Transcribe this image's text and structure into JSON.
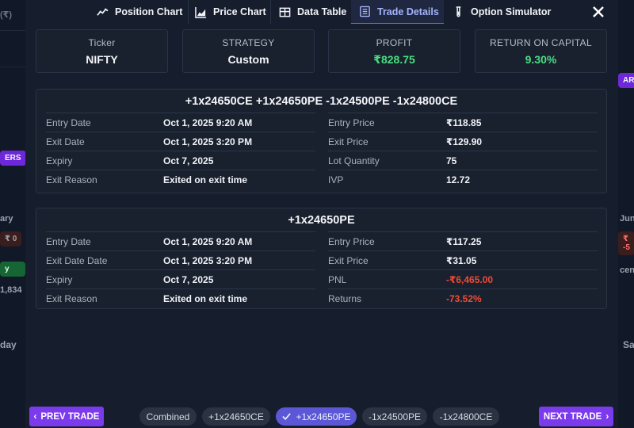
{
  "background": {
    "fragments": {
      "tl": "(₹)",
      "ers": "ERS",
      "ary": "ary",
      "zero": "₹ 0",
      "y": "y",
      "num": "1,834",
      "day": "day",
      "art": "ART",
      "june": "June",
      "neg": "₹ -5",
      "cen": "cen",
      "sa": "Sa"
    }
  },
  "tabs": [
    {
      "label": "Position Chart",
      "icon": "trend-line-icon"
    },
    {
      "label": "Price Chart",
      "icon": "area-chart-icon"
    },
    {
      "label": "Data Table",
      "icon": "table-icon"
    },
    {
      "label": "Trade Details",
      "icon": "document-list-icon",
      "active": true
    },
    {
      "label": "Option Simulator",
      "icon": "test-tube-icon"
    }
  ],
  "stats": [
    {
      "label": "Ticker",
      "value": "NIFTY"
    },
    {
      "label": "STRATEGY",
      "value": "Custom"
    },
    {
      "label": "PROFIT",
      "value": "₹828.75"
    },
    {
      "label": "RETURN ON CAPITAL",
      "value": "9.30%"
    }
  ],
  "combined_card": {
    "title": "+1x24650CE +1x24650PE -1x24500PE -1x24800CE",
    "left": [
      {
        "k": "Entry Date",
        "v": "Oct 1, 2025 9:20 AM"
      },
      {
        "k": "Exit Date",
        "v": "Oct 1, 2025 3:20 PM"
      },
      {
        "k": "Expiry",
        "v": "Oct 7, 2025"
      },
      {
        "k": "Exit Reason",
        "v": "Exited on exit time"
      }
    ],
    "right": [
      {
        "k": "Entry Price",
        "v": "₹118.85"
      },
      {
        "k": "Exit Price",
        "v": "₹129.90"
      },
      {
        "k": "Lot Quantity",
        "v": "75"
      },
      {
        "k": "IVP",
        "v": "12.72"
      }
    ]
  },
  "leg_card": {
    "title": "+1x24650PE",
    "left": [
      {
        "k": "Entry Date",
        "v": "Oct 1, 2025 9:20 AM"
      },
      {
        "k": "Exit Date Date",
        "v": "Oct 1, 2025 3:20 PM"
      },
      {
        "k": "Expiry",
        "v": "Oct 7, 2025"
      },
      {
        "k": "Exit Reason",
        "v": "Exited on exit time"
      }
    ],
    "right": [
      {
        "k": "Entry Price",
        "v": "₹117.25"
      },
      {
        "k": "Exit Price",
        "v": "₹31.05"
      },
      {
        "k": "PNL",
        "v": "-₹6,465.00"
      },
      {
        "k": "Returns",
        "v": "-73.52%"
      }
    ]
  },
  "footer": {
    "prev_label": "PREV TRADE",
    "next_label": "NEXT TRADE",
    "chips": [
      {
        "label": "Combined"
      },
      {
        "label": "+1x24650CE"
      },
      {
        "label": "+1x24650PE",
        "active": true
      },
      {
        "label": "-1x24500PE"
      },
      {
        "label": "-1x24800CE"
      }
    ]
  },
  "colors": {
    "accent": "#7c3aed",
    "profit": "#4ade80",
    "loss": "#f04a37",
    "active_chip": "#5b57d6"
  }
}
